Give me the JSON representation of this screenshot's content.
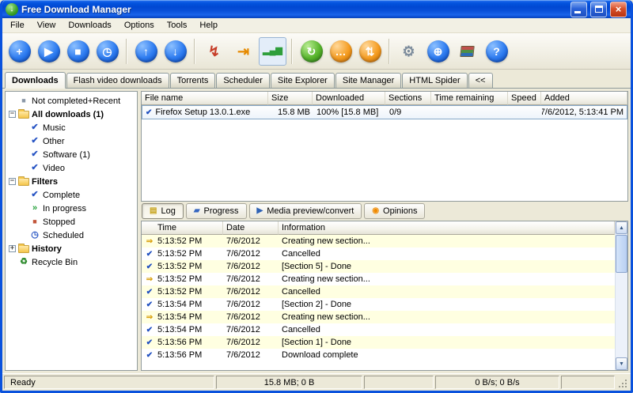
{
  "window": {
    "title": "Free Download Manager",
    "close_glyph": "×"
  },
  "menu": {
    "items": [
      "File",
      "View",
      "Downloads",
      "Options",
      "Tools",
      "Help"
    ]
  },
  "toolbar": {
    "groups": [
      [
        {
          "name": "add-download-button",
          "glyph": "+",
          "style": "blue"
        },
        {
          "name": "start-download-button",
          "glyph": "▶",
          "style": "blue"
        },
        {
          "name": "stop-download-button",
          "glyph": "■",
          "style": "blue"
        },
        {
          "name": "scheduler-button",
          "glyph": "◷",
          "style": "blue"
        }
      ],
      [
        {
          "name": "move-up-button",
          "glyph": "↑",
          "style": "blue"
        },
        {
          "name": "move-down-button",
          "glyph": "↓",
          "style": "blue"
        }
      ],
      [
        {
          "name": "hang-up-when-done-button",
          "glyph": "↯",
          "style": "flat",
          "color": "#c63d28"
        },
        {
          "name": "shutdown-when-done-button",
          "glyph": "⇥",
          "style": "flat",
          "color": "#e68a00"
        },
        {
          "name": "traffic-usage-mode-button",
          "glyph": "▂▄▆",
          "style": "flat bars",
          "color": "#2e9e3a",
          "pressed": true
        }
      ],
      [
        {
          "name": "flash-video-downloads-button",
          "glyph": "↻",
          "style": "green"
        },
        {
          "name": "community-button",
          "glyph": "…",
          "style": "orange"
        },
        {
          "name": "remote-control-button",
          "glyph": "⇅",
          "style": "orange"
        }
      ],
      [
        {
          "name": "settings-button",
          "glyph": "⚙",
          "style": "flat",
          "color": "#7d8c9c"
        },
        {
          "name": "site-explorer-button",
          "glyph": "⊕",
          "style": "blue"
        },
        {
          "name": "tutorials-button",
          "glyph": "",
          "style": "books"
        },
        {
          "name": "help-button",
          "glyph": "?",
          "style": "blue"
        }
      ]
    ]
  },
  "main_tabs": {
    "active": "Downloads",
    "items": [
      "Downloads",
      "Flash video downloads",
      "Torrents",
      "Scheduler",
      "Site Explorer",
      "Site Manager",
      "HTML Spider",
      "<<"
    ]
  },
  "sidebar": {
    "items": [
      {
        "label": "Not completed+Recent",
        "icon": "recent",
        "indent": 0,
        "expander": null,
        "bold": false
      },
      {
        "label": "All downloads (1)",
        "icon": "folder",
        "indent": 0,
        "expander": "minus",
        "bold": true
      },
      {
        "label": "Music",
        "icon": "category-check",
        "indent": 1,
        "expander": null,
        "bold": false
      },
      {
        "label": "Other",
        "icon": "category-check",
        "indent": 1,
        "expander": null,
        "bold": false
      },
      {
        "label": "Software (1)",
        "icon": "category-check",
        "indent": 1,
        "expander": null,
        "bold": false
      },
      {
        "label": "Video",
        "icon": "category-check",
        "indent": 1,
        "expander": null,
        "bold": false
      },
      {
        "label": "Filters",
        "icon": "folder",
        "indent": 0,
        "expander": "minus",
        "bold": true
      },
      {
        "label": "Complete",
        "icon": "category-check",
        "indent": 1,
        "expander": null,
        "bold": false
      },
      {
        "label": "In progress",
        "icon": "in-progress",
        "indent": 1,
        "expander": null,
        "bold": false
      },
      {
        "label": "Stopped",
        "icon": "stopped",
        "indent": 1,
        "expander": null,
        "bold": false
      },
      {
        "label": "Scheduled",
        "icon": "clock",
        "indent": 1,
        "expander": null,
        "bold": false
      },
      {
        "label": "History",
        "icon": "folder",
        "indent": 0,
        "expander": "plus",
        "bold": true
      },
      {
        "label": "Recycle Bin",
        "icon": "recycle",
        "indent": 0,
        "expander": null,
        "bold": false
      }
    ]
  },
  "downloads": {
    "columns": [
      "File name",
      "Size",
      "Downloaded",
      "Sections",
      "Time remaining",
      "Speed",
      "Added"
    ],
    "rows": [
      {
        "file": "Firefox Setup 13.0.1.exe",
        "size": "15.8 MB",
        "downloaded": "100% [15.8 MB]",
        "sections": "0/9",
        "time_remaining": "",
        "speed": "",
        "added": "7/6/2012, 5:13:41 PM",
        "icon": "check"
      }
    ]
  },
  "bottom_tabs": {
    "active": "Log",
    "items": [
      {
        "label": "Log",
        "icon": "log"
      },
      {
        "label": "Progress",
        "icon": "progress"
      },
      {
        "label": "Media preview/convert",
        "icon": "media"
      },
      {
        "label": "Opinions",
        "icon": "opinions"
      }
    ]
  },
  "log": {
    "columns": [
      "Time",
      "Date",
      "Information"
    ],
    "rows": [
      {
        "time": "5:13:52 PM",
        "date": "7/6/2012",
        "info": "Creating new section...",
        "icon": "arrow"
      },
      {
        "time": "5:13:52 PM",
        "date": "7/6/2012",
        "info": "Cancelled",
        "icon": "check"
      },
      {
        "time": "5:13:52 PM",
        "date": "7/6/2012",
        "info": "[Section 5] - Done",
        "icon": "check"
      },
      {
        "time": "5:13:52 PM",
        "date": "7/6/2012",
        "info": "Creating new section...",
        "icon": "arrow"
      },
      {
        "time": "5:13:52 PM",
        "date": "7/6/2012",
        "info": "Cancelled",
        "icon": "check"
      },
      {
        "time": "5:13:54 PM",
        "date": "7/6/2012",
        "info": "[Section 2] - Done",
        "icon": "check"
      },
      {
        "time": "5:13:54 PM",
        "date": "7/6/2012",
        "info": "Creating new section...",
        "icon": "arrow"
      },
      {
        "time": "5:13:54 PM",
        "date": "7/6/2012",
        "info": "Cancelled",
        "icon": "check"
      },
      {
        "time": "5:13:56 PM",
        "date": "7/6/2012",
        "info": "[Section 1] - Done",
        "icon": "check"
      },
      {
        "time": "5:13:56 PM",
        "date": "7/6/2012",
        "info": "Download complete",
        "icon": "check"
      }
    ]
  },
  "statusbar": {
    "ready": "Ready",
    "sizes": "15.8 MB; 0 B",
    "speeds": "0 B/s; 0 B/s"
  },
  "icons": {
    "app": {
      "glyph": "↓",
      "color": "#ffffff"
    },
    "arrow": {
      "glyph": "⇒",
      "color": "#d79b00"
    },
    "check": {
      "glyph": "✔",
      "color": "#1f4fc0"
    },
    "folder": {
      "glyph": "",
      "color": "#f5c64a"
    },
    "category-check": {
      "glyph": "✔",
      "color": "#2855c4"
    },
    "in-progress": {
      "glyph": "»",
      "color": "#22a038"
    },
    "stopped": {
      "glyph": "■",
      "color": "#c2553a"
    },
    "recent": {
      "glyph": "■",
      "color": "#8b98a8"
    },
    "clock": {
      "glyph": "◷",
      "color": "#2855c4"
    },
    "recycle": {
      "glyph": "♻",
      "color": "#2e8b2e"
    },
    "log": {
      "glyph": "▤",
      "color": "#c7a31b"
    },
    "progress": {
      "glyph": "▰",
      "color": "#3566c0"
    },
    "media": {
      "glyph": "▶",
      "color": "#2f62b5"
    },
    "opinions": {
      "glyph": "◉",
      "color": "#f08a00"
    },
    "expander_minus": {
      "glyph": "−"
    },
    "expander_plus": {
      "glyph": "+"
    },
    "scroll_up": {
      "glyph": "▲"
    },
    "scroll_down": {
      "glyph": "▼"
    }
  }
}
